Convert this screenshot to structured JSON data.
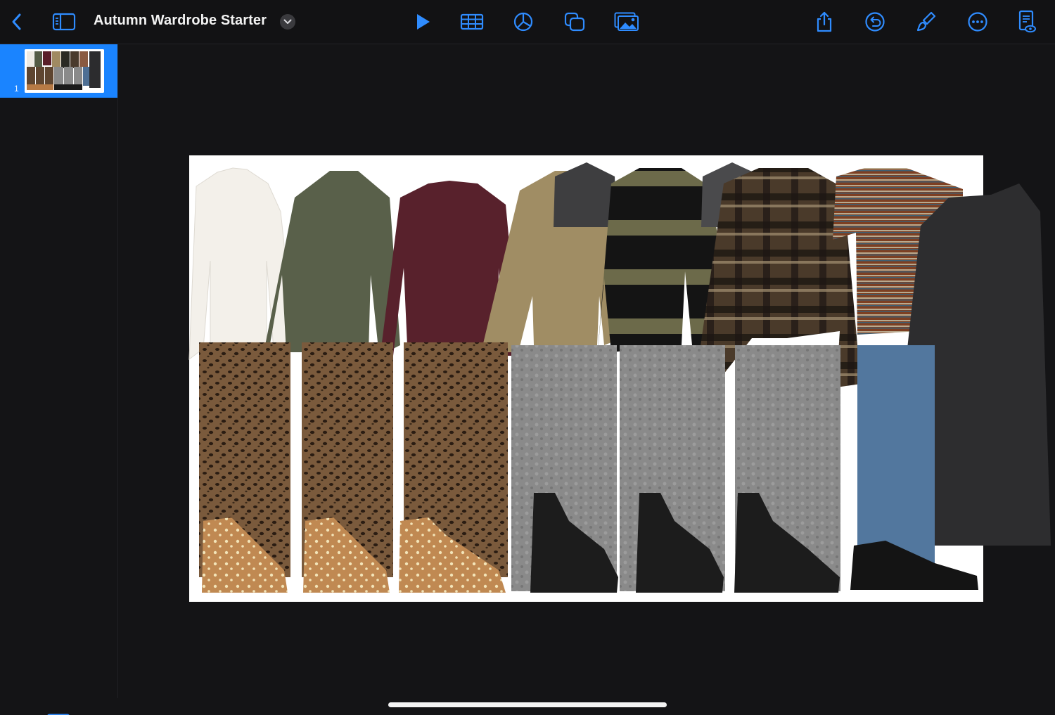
{
  "toolbar": {
    "document_title": "Autumn Wardrobe Starter",
    "icons": {
      "back": "chevron-left-icon",
      "navigator": "sidebar-icon",
      "title_menu": "chevron-down-icon",
      "play": "play-icon",
      "table": "table-icon",
      "chart": "chart-icon",
      "shape": "shape-icon",
      "media": "media-icon",
      "share": "share-icon",
      "undo": "undo-icon",
      "format": "paintbrush-icon",
      "more": "ellipsis-icon",
      "presenter": "document-view-icon"
    }
  },
  "navigator": {
    "slides": [
      {
        "number": "1",
        "selected": true
      }
    ],
    "add_slide_icon": "plus-square-icon"
  },
  "slide": {
    "content": "outfit collage photo"
  },
  "colors": {
    "accent": "#1a84ff",
    "background": "#141416",
    "toolbar_icon": "#2f8cff"
  }
}
